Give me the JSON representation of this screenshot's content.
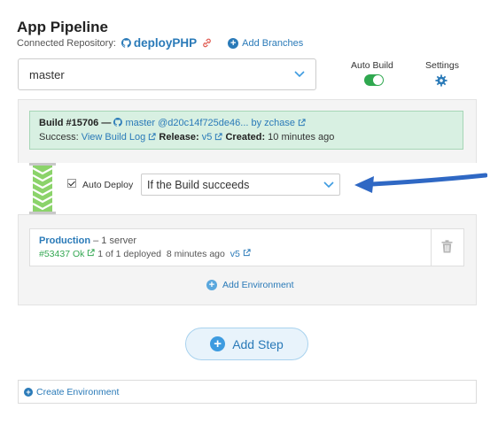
{
  "header": {
    "title": "App Pipeline",
    "repo_label": "Connected Repository:",
    "repo_name": "deployPHP",
    "add_branches": "Add Branches"
  },
  "branch_select": {
    "value": "master"
  },
  "controls": {
    "auto_build_label": "Auto Build",
    "auto_build_on": true,
    "settings_label": "Settings"
  },
  "build": {
    "number": "Build #15706 —",
    "commit": "master @d20c14f725de46... by zchase",
    "status_label": "Success:",
    "view_log": "View Build Log",
    "release_label": "Release:",
    "release_value": "v5",
    "created_label": "Created:",
    "created_value": "10 minutes ago"
  },
  "auto_deploy": {
    "label": "Auto Deploy",
    "checked": true,
    "select_value": "If the Build succeeds"
  },
  "environment": {
    "name": "Production",
    "servers": " – 1 server",
    "status": "#53437 Ok",
    "deployed": "1 of 1 deployed",
    "time": "8 minutes ago",
    "release": "v5"
  },
  "actions": {
    "add_environment": "Add Environment",
    "add_step": "Add Step",
    "create_environment": "Create Environment"
  },
  "colors": {
    "link": "#2a7ab8",
    "success": "#35a853",
    "build_bg": "#d8f0e2",
    "toggle_on": "#2fa84f"
  }
}
